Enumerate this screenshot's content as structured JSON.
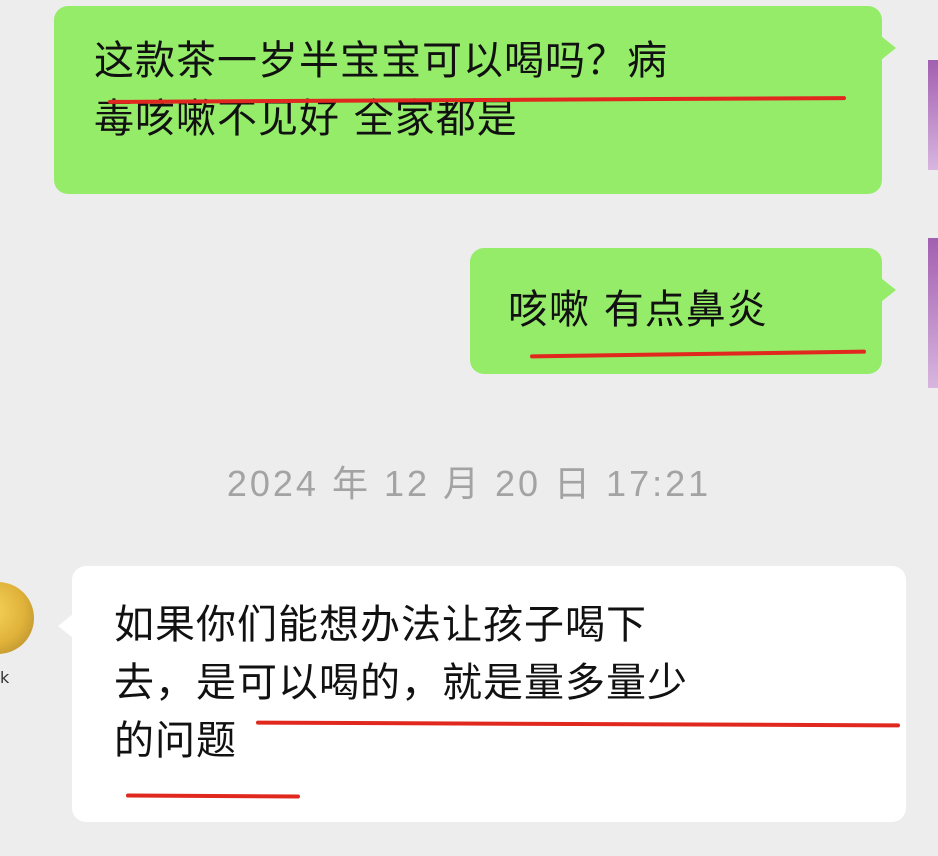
{
  "messages": [
    {
      "side": "right",
      "lines": [
        "这款茶一岁半宝宝可以喝吗？病",
        "毒咳嗽不见好 全家都是"
      ]
    },
    {
      "side": "right",
      "lines": [
        "咳嗽 有点鼻炎"
      ]
    },
    {
      "side": "left",
      "lines": [
        "如果你们能想办法让孩子喝下",
        "去，是可以喝的，就是量多量少",
        "的问题"
      ]
    }
  ],
  "timestamp": "2024 年 12 月 20 日  17:21",
  "avatar_caption": "k",
  "colors": {
    "outgoing_bubble": "#95ec69",
    "incoming_bubble": "#ffffff",
    "background": "#ededed",
    "underline": "#e0281e",
    "timestamp": "#a3a3a3"
  }
}
